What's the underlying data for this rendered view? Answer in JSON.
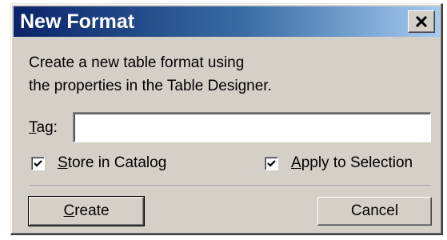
{
  "dialog": {
    "title": "New Format",
    "close_label": "✕",
    "description_line1": "Create a new table format using",
    "description_line2": "the properties in the Table Designer.",
    "tag": {
      "label": "Tag:",
      "value": ""
    },
    "store_in_catalog": {
      "label": "Store in Catalog",
      "checked": true
    },
    "apply_to_selection": {
      "label": "Apply to Selection",
      "checked": true
    },
    "create_button": "Create",
    "cancel_button": "Cancel"
  },
  "colors": {
    "title_bar_start": "#0a246a",
    "title_bar_end": "#a6caf0",
    "dialog_face": "#d4d0c8"
  },
  "icons": {
    "close": "close-icon",
    "check": "checkmark-icon"
  }
}
